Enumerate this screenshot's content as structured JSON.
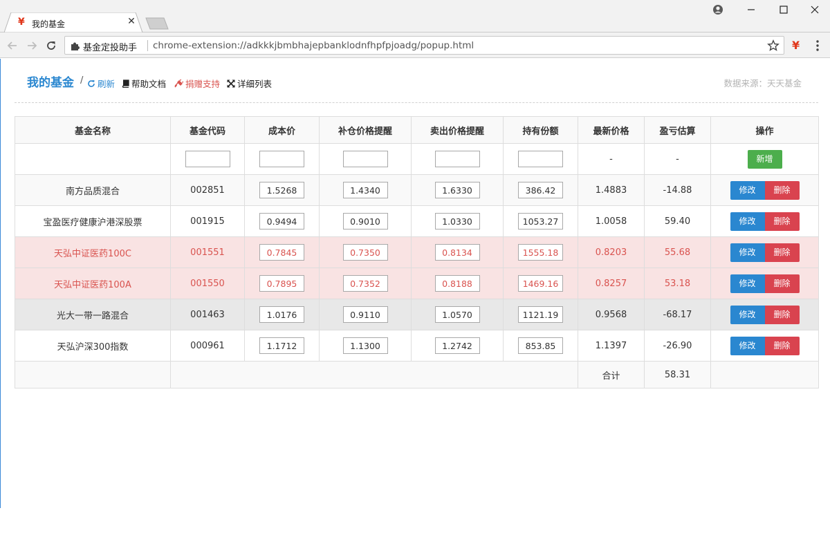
{
  "browser": {
    "tab_title": "我的基金",
    "tab_favicon": "¥",
    "omnibox_ext_name": "基金定投助手",
    "url": "chrome-extension://adkkkjbmbhajepbanklodnfhpfpjoadg/popup.html",
    "extension_icon": "¥",
    "icons": [
      "back-arrow-icon",
      "forward-arrow-icon",
      "reload-icon",
      "puzzle-icon",
      "star-icon",
      "menu-dots-icon",
      "account-icon",
      "minimize-icon",
      "maximize-icon",
      "close-icon"
    ]
  },
  "header": {
    "title": "我的基金",
    "separator": "/",
    "refresh_label": "刷新",
    "help_label": "帮助文档",
    "donate_label": "捐赠支持",
    "detail_label": "详细列表",
    "source_label": "数据来源：天天基金"
  },
  "colors": {
    "brand": "#2a87d0",
    "add_button": "#4cae4c",
    "edit_button": "#2a87d0",
    "delete_button": "#d9434f",
    "danger_row_bg": "#f9e3e3",
    "danger_text": "#d9534f"
  },
  "table": {
    "columns": [
      "基金名称",
      "基金代码",
      "成本价",
      "补仓价格提醒",
      "卖出价格提醒",
      "持有份额",
      "最新价格",
      "盈亏估算",
      "操作"
    ],
    "input_row": {
      "latest_price": "-",
      "pnl": "-",
      "add_label": "新增",
      "code": "",
      "cost": "",
      "buy_alert": "",
      "sell_alert": "",
      "shares": ""
    },
    "rows": [
      {
        "name": "南方品质混合",
        "code": "002851",
        "cost": "1.5268",
        "buy_alert": "1.4340",
        "sell_alert": "1.6330",
        "shares": "386.42",
        "latest": "1.4883",
        "pnl": "-14.88",
        "edit": "修改",
        "delete": "删除"
      },
      {
        "name": "宝盈医疗健康沪港深股票",
        "code": "001915",
        "cost": "0.9494",
        "buy_alert": "0.9010",
        "sell_alert": "1.0330",
        "shares": "1053.27",
        "latest": "1.0058",
        "pnl": "59.40",
        "edit": "修改",
        "delete": "删除"
      },
      {
        "name": "天弘中证医药100C",
        "code": "001551",
        "cost": "0.7845",
        "buy_alert": "0.7350",
        "sell_alert": "0.8134",
        "shares": "1555.18",
        "latest": "0.8203",
        "pnl": "55.68",
        "edit": "修改",
        "delete": "删除"
      },
      {
        "name": "天弘中证医药100A",
        "code": "001550",
        "cost": "0.7895",
        "buy_alert": "0.7352",
        "sell_alert": "0.8188",
        "shares": "1469.16",
        "latest": "0.8257",
        "pnl": "53.18",
        "edit": "修改",
        "delete": "删除"
      },
      {
        "name": "光大一带一路混合",
        "code": "001463",
        "cost": "1.0176",
        "buy_alert": "0.9110",
        "sell_alert": "1.0570",
        "shares": "1121.19",
        "latest": "0.9568",
        "pnl": "-68.17",
        "edit": "修改",
        "delete": "删除"
      },
      {
        "name": "天弘沪深300指数",
        "code": "000961",
        "cost": "1.1712",
        "buy_alert": "1.1300",
        "sell_alert": "1.2742",
        "shares": "853.85",
        "latest": "1.1397",
        "pnl": "-26.90",
        "edit": "修改",
        "delete": "删除"
      }
    ],
    "footer": {
      "total_label": "合计",
      "total_value": "58.31"
    }
  }
}
